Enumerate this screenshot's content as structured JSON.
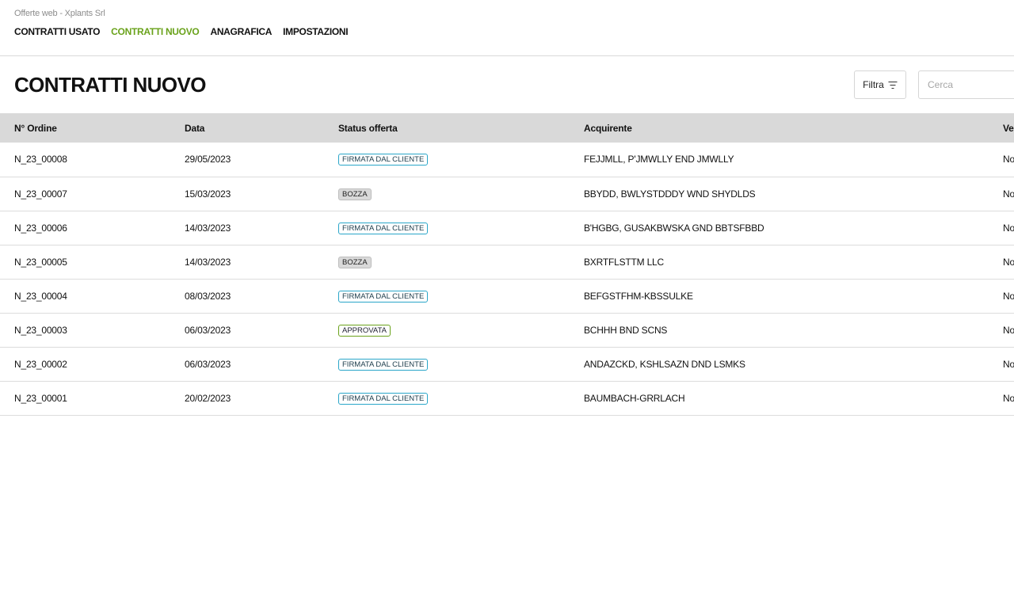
{
  "app": {
    "title": "Offerte web - Xplants Srl"
  },
  "nav": [
    {
      "label": "CONTRATTI USATO",
      "active": false
    },
    {
      "label": "CONTRATTI NUOVO",
      "active": true
    },
    {
      "label": "ANAGRAFICA",
      "active": false
    },
    {
      "label": "IMPOSTAZIONI",
      "active": false
    }
  ],
  "page": {
    "title": "CONTRATTI NUOVO"
  },
  "toolbar": {
    "filter_label": "Filtra",
    "filter_icon": "filter-icon",
    "search_placeholder": "Cerca"
  },
  "colors": {
    "accent": "#6aa21b",
    "badge_signed": "#2aa6c9",
    "header_bg": "#d9d9d9"
  },
  "table": {
    "columns": [
      "N° Ordine",
      "Data",
      "Status offerta",
      "Acquirente",
      "Ve"
    ],
    "rows": [
      {
        "ordine": "N_23_00008",
        "data": "29/05/2023",
        "status": "FIRMATA DAL CLIENTE",
        "status_type": "firmata",
        "acquirente": "FEJJMLL, P'JMWLLY END JMWLLY",
        "ve": "No"
      },
      {
        "ordine": "N_23_00007",
        "data": "15/03/2023",
        "status": "BOZZA",
        "status_type": "bozza",
        "acquirente": "BBYDD, BWLYSTDDDY WND SHYDLDS",
        "ve": "No"
      },
      {
        "ordine": "N_23_00006",
        "data": "14/03/2023",
        "status": "FIRMATA DAL CLIENTE",
        "status_type": "firmata",
        "acquirente": "B'HGBG, GUSAKBWSKA GND BBTSFBBD",
        "ve": "No"
      },
      {
        "ordine": "N_23_00005",
        "data": "14/03/2023",
        "status": "BOZZA",
        "status_type": "bozza",
        "acquirente": "BXRTFLSTTM LLC",
        "ve": "No"
      },
      {
        "ordine": "N_23_00004",
        "data": "08/03/2023",
        "status": "FIRMATA DAL CLIENTE",
        "status_type": "firmata",
        "acquirente": "BEFGSTFHM-KBSSULKE",
        "ve": "No"
      },
      {
        "ordine": "N_23_00003",
        "data": "06/03/2023",
        "status": "APPROVATA",
        "status_type": "approvata",
        "acquirente": "BCHHH BND SCNS",
        "ve": "No"
      },
      {
        "ordine": "N_23_00002",
        "data": "06/03/2023",
        "status": "FIRMATA DAL CLIENTE",
        "status_type": "firmata",
        "acquirente": "ANDAZCKD, KSHLSAZN DND LSMKS",
        "ve": "No"
      },
      {
        "ordine": "N_23_00001",
        "data": "20/02/2023",
        "status": "FIRMATA DAL CLIENTE",
        "status_type": "firmata",
        "acquirente": "BAUMBACH-GRRLACH",
        "ve": "No"
      }
    ]
  }
}
